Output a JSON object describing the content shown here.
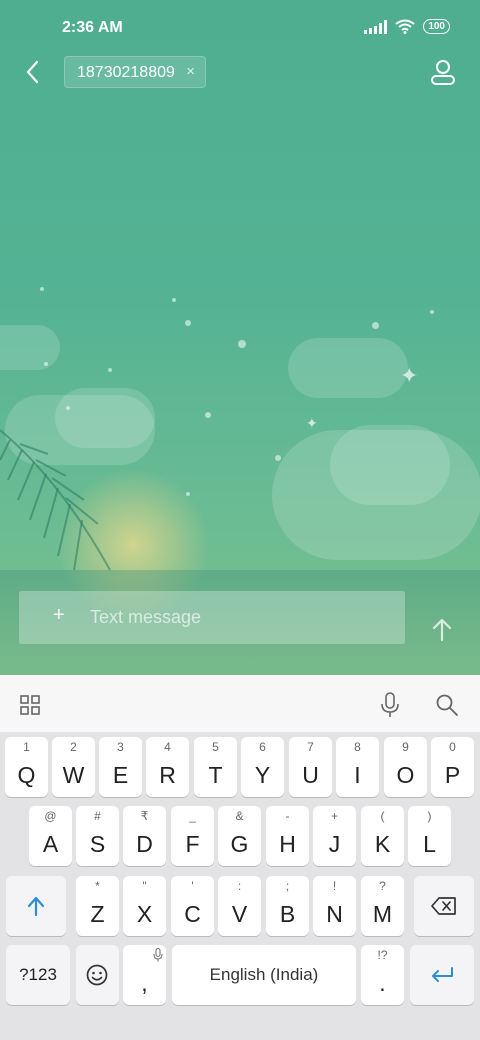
{
  "status_bar": {
    "time": "2:36 AM",
    "battery": "100"
  },
  "header": {
    "recipient": "18730218809",
    "remove_symbol": "×"
  },
  "compose": {
    "plus": "+",
    "placeholder": "Text message"
  },
  "keyboard": {
    "row1": [
      {
        "hint": "1",
        "key": "Q"
      },
      {
        "hint": "2",
        "key": "W"
      },
      {
        "hint": "3",
        "key": "E"
      },
      {
        "hint": "4",
        "key": "R"
      },
      {
        "hint": "5",
        "key": "T"
      },
      {
        "hint": "6",
        "key": "Y"
      },
      {
        "hint": "7",
        "key": "U"
      },
      {
        "hint": "8",
        "key": "I"
      },
      {
        "hint": "9",
        "key": "O"
      },
      {
        "hint": "0",
        "key": "P"
      }
    ],
    "row2": [
      {
        "hint": "@",
        "key": "A"
      },
      {
        "hint": "#",
        "key": "S"
      },
      {
        "hint": "₹",
        "key": "D"
      },
      {
        "hint": "_",
        "key": "F"
      },
      {
        "hint": "&",
        "key": "G"
      },
      {
        "hint": "-",
        "key": "H"
      },
      {
        "hint": "+",
        "key": "J"
      },
      {
        "hint": "(",
        "key": "K"
      },
      {
        "hint": ")",
        "key": "L"
      }
    ],
    "row3": [
      {
        "hint": "*",
        "key": "Z"
      },
      {
        "hint": "\"",
        "key": "X"
      },
      {
        "hint": "'",
        "key": "C"
      },
      {
        "hint": ":",
        "key": "V"
      },
      {
        "hint": ";",
        "key": "B"
      },
      {
        "hint": "!",
        "key": "N"
      },
      {
        "hint": "?",
        "key": "M"
      }
    ],
    "symbols_label": "?123",
    "comma": ",",
    "space_label": "English (India)",
    "period": ".",
    "period_hint": "!?"
  },
  "colors": {
    "accent": "#2b8fd6",
    "scene_green": "#52b193"
  },
  "icons": [
    "back-arrow-icon",
    "contact-icon",
    "send-arrow-icon",
    "apps-grid-icon",
    "microphone-icon",
    "search-icon",
    "shift-icon",
    "backspace-icon",
    "emoji-icon",
    "enter-icon"
  ]
}
